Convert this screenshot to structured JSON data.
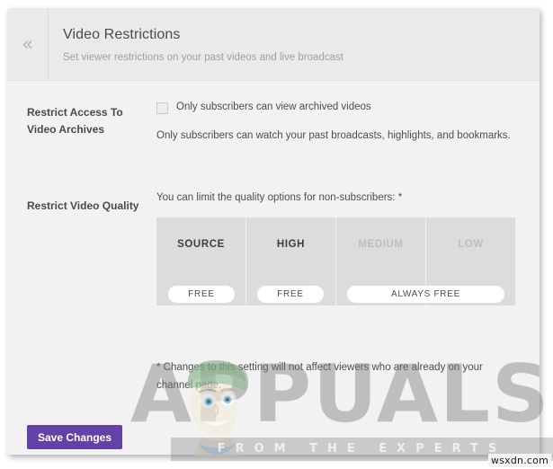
{
  "header": {
    "collapse_icon": "chevron-double-left-icon",
    "collapse_glyph": "«",
    "title": "Video Restrictions",
    "subtitle": "Set viewer restrictions on your past videos and live broadcast"
  },
  "sections": {
    "archives": {
      "label": "Restrict Access To Video Archives",
      "checkbox_label": "Only subscribers can view archived videos",
      "checkbox_checked": false,
      "help_text": "Only subscribers can watch your past broadcasts, highlights, and bookmarks."
    },
    "quality": {
      "label": "Restrict Video Quality",
      "intro": "You can limit the quality options for non-subscribers: *",
      "columns": [
        {
          "name": "SOURCE",
          "disabled": false
        },
        {
          "name": "HIGH",
          "disabled": false
        },
        {
          "name": "MEDIUM",
          "disabled": true
        },
        {
          "name": "LOW",
          "disabled": true
        }
      ],
      "pills": [
        {
          "label": "FREE",
          "span": "source"
        },
        {
          "label": "FREE",
          "span": "high"
        },
        {
          "label": "ALWAYS FREE",
          "span": "medium-low"
        }
      ],
      "footnote": "* Changes to this setting will not affect viewers who are already on your channel page."
    }
  },
  "footer": {
    "save_label": "Save Changes"
  },
  "watermark": {
    "brand": "APPUALS",
    "tagline": "FROM THE EXPERTS",
    "site": "wsxdn.com"
  },
  "colors": {
    "accent_purple": "#6441a5",
    "panel_bg": "#f2f2f2",
    "header_bg": "#eaeaea",
    "table_bg": "#dcdcdc",
    "text_primary": "#4d4d4d",
    "text_muted": "#a0a0a0",
    "text_disabled": "#bdbdbd"
  }
}
